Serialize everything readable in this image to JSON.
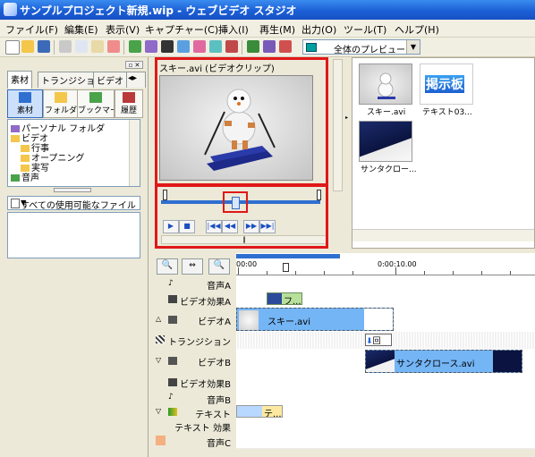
{
  "window": {
    "title": "サンプルプロジェクト新規.wip - ウェブビデオ スタジオ"
  },
  "menu": [
    "ファイル(F)",
    "編集(E)",
    "表示(V)",
    "キャプチャー(C)",
    "挿入(I)",
    "再生(M)",
    "出力(O)",
    "ツール(T)",
    "ヘルプ(H)"
  ],
  "toolbar": {
    "preview_mode": "全体のプレビュー"
  },
  "left_panel": {
    "tabs": [
      "素材",
      "トランジション",
      "ビデオ"
    ],
    "categories": [
      "素材",
      "フォルダ",
      "ブックマーク",
      "履歴"
    ],
    "tree": [
      "パーソナル フォルダ",
      "ビデオ",
      "行事",
      "オープニング",
      "実写",
      "音声"
    ],
    "filter": "すべての使用可能なファイル"
  },
  "preview": {
    "title": "スキー.avi (ビデオクリップ)"
  },
  "media": {
    "clips": [
      {
        "label": "スキー.avi"
      },
      {
        "label": "テキスト03...",
        "thumb_text": "掲示板"
      },
      {
        "label": "サンタクロー..."
      }
    ]
  },
  "timeline": {
    "ruler_labels": [
      "00:00",
      "0:00:10.00"
    ],
    "tracks": [
      "音声A",
      "ビデオ効果A",
      "ビデオA",
      "トランジション",
      "ビデオB",
      "ビデオ効果B",
      "音声B",
      "テキスト",
      "テキスト 効果",
      "音声C"
    ],
    "clips": {
      "effect_a": "フ...",
      "video_a": "スキー.avi",
      "video_b": "サンタクロース.avi",
      "text": "テ..."
    }
  },
  "colors": {
    "accent": "#2f6fd0",
    "highlight": "#e01818",
    "clip": "#74b5f5"
  }
}
